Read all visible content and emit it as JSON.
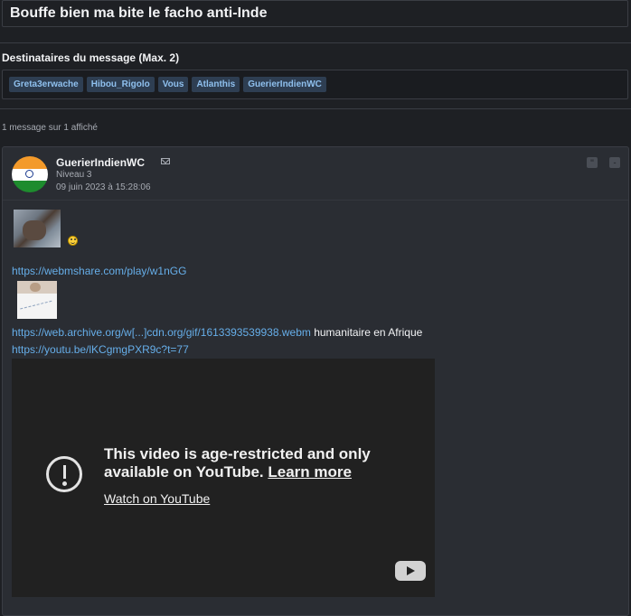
{
  "subject": "Bouffe bien ma bite le facho anti-Inde",
  "recipients": {
    "title": "Destinataires du message (Max. 2)",
    "names": [
      "Greta3erwache",
      "Hibou_Rigolo",
      "Vous",
      "Atlanthis",
      "GuerierIndienWC"
    ]
  },
  "count_text": "1 message sur 1 affiché",
  "message": {
    "author": "GuerierIndienWC",
    "level": "Niveau 3",
    "date": "09 juin 2023 à 15:28:06",
    "link1": "https://webmshare.com/play/w1nGG",
    "link2": "https://web.archive.org/w[...]cdn.org/gif/1613393539938.webm",
    "after_link2": " humanitaire en Afrique",
    "link3": "https://youtu.be/lKCgmgPXR9c?t=77"
  },
  "video": {
    "message_main": "This video is age-restricted and only available on YouTube. ",
    "learn_more": "Learn more",
    "watch": "Watch on YouTube"
  }
}
